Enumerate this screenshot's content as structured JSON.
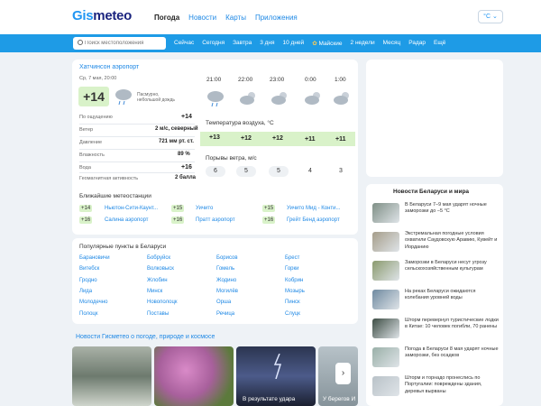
{
  "logo": {
    "a": "Gis",
    "b": "meteo"
  },
  "topnav": [
    "Погода",
    "Новости",
    "Карты",
    "Приложения"
  ],
  "unit": "°C ⌄",
  "search": {
    "placeholder": "Поиск местоположения"
  },
  "bluenav": [
    "Сейчас",
    "Сегодня",
    "Завтра",
    "3 дня",
    "10 дней",
    "Майские",
    "2 недели",
    "Месяц",
    "Радар",
    "Ещё"
  ],
  "weather": {
    "location": "Хатчинсон аэропорт",
    "datetime": "Ср, 7 мая, 20:00",
    "temp": "+14",
    "desc": "Пасмурно, небольшой дождь",
    "stats": [
      {
        "label": "По ощущению",
        "value": "+14"
      },
      {
        "label": "Ветер",
        "value": "2 м/с, северный"
      },
      {
        "label": "Давление",
        "value": "721 мм рт. ст."
      },
      {
        "label": "Влажность",
        "value": "89 %"
      },
      {
        "label": "Вода",
        "value": "+16"
      },
      {
        "label": "Геомагнитная активность",
        "value": "2 балла"
      }
    ],
    "hours": [
      "21:00",
      "22:00",
      "23:00",
      "0:00",
      "1:00"
    ],
    "temp_label": "Температура воздуха, °C",
    "temps": [
      "+13",
      "+12",
      "+12",
      "+11",
      "+11"
    ],
    "wind_label": "Порывы ветра, м/с",
    "winds": [
      "6",
      "5",
      "5",
      "4",
      "3"
    ]
  },
  "stations": {
    "title": "Ближайшие метеостанции",
    "items": [
      {
        "t": "+14",
        "n": "Ньютон-Сити-Каунт..."
      },
      {
        "t": "+16",
        "n": "Салина аэропорт"
      },
      {
        "t": "+15",
        "n": "Уичито"
      },
      {
        "t": "+16",
        "n": "Пратт аэропорт"
      },
      {
        "t": "+15",
        "n": "Уичито Мид - Конти..."
      },
      {
        "t": "+16",
        "n": "Грейт Бенд аэропорт"
      }
    ]
  },
  "popular": {
    "title": "Популярные пункты в Беларуси",
    "cols": [
      [
        "Барановичи",
        "Витебск",
        "Гродно",
        "Лида",
        "Молодечно",
        "Полоцк"
      ],
      [
        "Бобруйск",
        "Волковыск",
        "Жлобин",
        "Минск",
        "Новополоцк",
        "Поставы"
      ],
      [
        "Борисов",
        "Гомель",
        "Жодино",
        "Могилёв",
        "Орша",
        "Речица"
      ],
      [
        "Брест",
        "Горки",
        "Кобрин",
        "Мозырь",
        "Пинск",
        "Слуцк"
      ]
    ]
  },
  "news_bottom": {
    "title": "Новости Гисметео о погоде, природе и космосе",
    "cards": [
      "",
      "",
      "В результате удара",
      "У берегов И"
    ]
  },
  "news_side": {
    "title": "Новости Беларуси и мира",
    "items": [
      "В Беларуси 7–9 мая ударят ночные заморозки до −5 °C",
      "Экстремальная погодные условия охватили Саудовскую Аравию, Кувейт и Иорданию",
      "Заморозки в Беларуси несут угрозу сельскохозяйственным культурам",
      "На реках Беларуси ожидаются колебания уровней воды",
      "Шторм перевернул туристические лодки в Китае: 10 человек погибли, 70 ранены",
      "Погода в Беларуси 8 мая ударят ночные заморозки, без осадков",
      "Шторм и торнадо пронеслись по Португалии: повреждены здания, деревья вырваны"
    ]
  }
}
